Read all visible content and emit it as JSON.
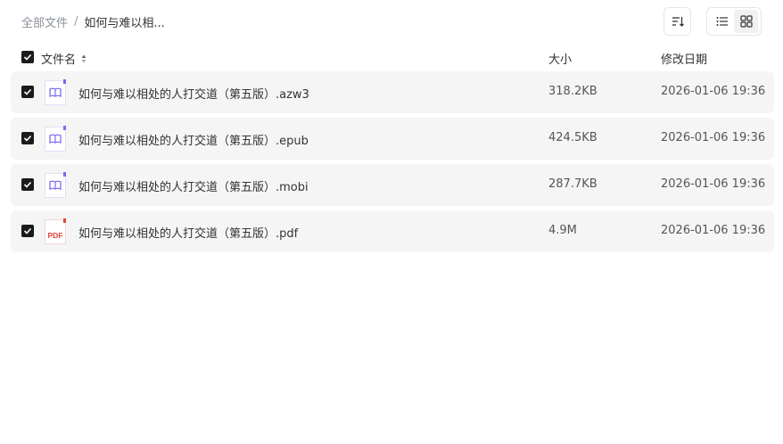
{
  "breadcrumb": {
    "root": "全部文件",
    "separator": "/",
    "current": "如何与难以相..."
  },
  "toolbar": {
    "sort_icon": "sort-icon",
    "list_view_icon": "list-view-icon",
    "grid_view_icon": "grid-view-icon",
    "active_view": "list"
  },
  "table": {
    "headers": {
      "name": "文件名",
      "size": "大小",
      "date": "修改日期"
    },
    "header_checked": true,
    "rows": [
      {
        "name": "如何与难以相处的人打交道（第五版）.azw3",
        "size": "318.2KB",
        "date": "2026-01-06 19:36",
        "icon": "ebook-icon",
        "checked": true
      },
      {
        "name": "如何与难以相处的人打交道（第五版）.epub",
        "size": "424.5KB",
        "date": "2026-01-06 19:36",
        "icon": "ebook-icon",
        "checked": true
      },
      {
        "name": "如何与难以相处的人打交道（第五版）.mobi",
        "size": "287.7KB",
        "date": "2026-01-06 19:36",
        "icon": "ebook-icon",
        "checked": true
      },
      {
        "name": "如何与难以相处的人打交道（第五版）.pdf",
        "size": "4.9M",
        "date": "2026-01-06 19:36",
        "icon": "pdf-icon",
        "checked": true
      }
    ]
  },
  "icons": {
    "pdf_label": "PDF"
  },
  "colors": {
    "ebook_accent": "#7b6cf0",
    "pdf_accent": "#e5453b",
    "row_bg": "#f5f5f6",
    "checkbox": "#1a1a1a"
  }
}
